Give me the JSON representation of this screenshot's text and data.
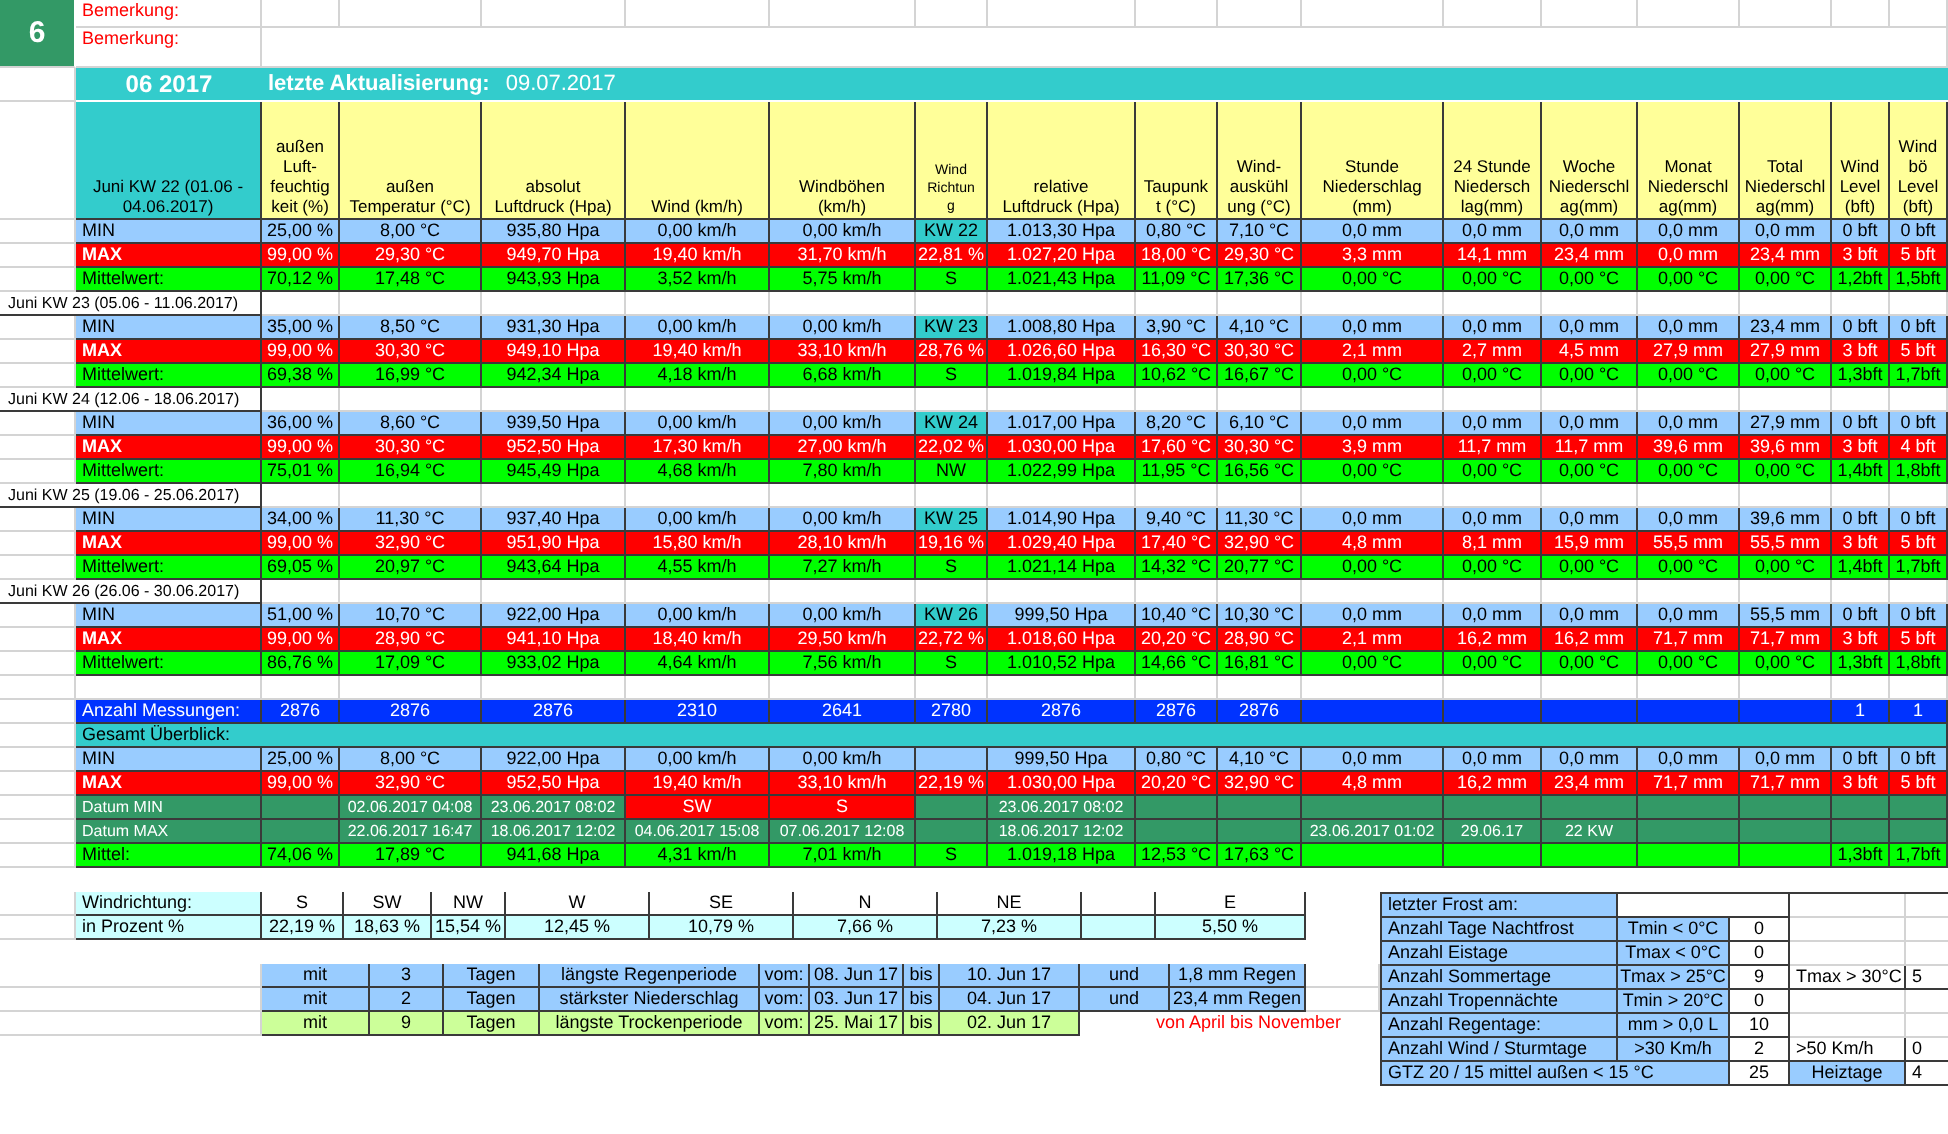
{
  "sheet_number": "6",
  "remarks": [
    "Bemerkung:",
    "Bemerkung:"
  ],
  "title": {
    "period": "06 2017",
    "update_label": "letzte Aktualisierung:",
    "update_date": "09.07.2017"
  },
  "columns": [
    "außen\nLuft-\nfeuchtig\nkeit (%)",
    "außen\nTemperatur (°C)",
    "absolut\nLuftdruck (Hpa)",
    "Wind  (km/h)",
    "Windböhen\n(km/h)",
    "Wind\nRichtun\ng",
    "relative\nLuftdruck (Hpa)",
    "Taupunk\nt (°C)",
    "Wind-\nauskühl\nung (°C)",
    "Stunde\nNiederschlag\n(mm)",
    "24 Stunde\nNiedersch\nlag(mm)",
    "Woche\nNiederschl\nag(mm)",
    "Monat\nNiederschl\nag(mm)",
    "Total\nNiederschl\nag(mm)",
    "Wind\nLevel\n(bft)",
    "Wind\nbö\nLevel\n(bft)"
  ],
  "weeks": [
    {
      "label": "Juni KW 22 (01.06 - 04.06.2017)",
      "rows": [
        {
          "kind": "min",
          "label": "MIN",
          "cells": [
            "25,00 %",
            "8,00 °C",
            "935,80 Hpa",
            "0,00 km/h",
            "0,00 km/h",
            {
              "text": "KW 22",
              "kind": "week"
            },
            "1.013,30 Hpa",
            "0,80 °C",
            "7,10 °C",
            "0,0 mm",
            "0,0 mm",
            "0,0 mm",
            "0,0 mm",
            "0,0 mm",
            "0 bft",
            "0 bft"
          ]
        },
        {
          "kind": "max",
          "label": "MAX",
          "cells": [
            "99,00 %",
            "29,30 °C",
            "949,70 Hpa",
            "19,40 km/h",
            "31,70 km/h",
            "22,81 %",
            "1.027,20 Hpa",
            "18,00 °C",
            "29,30 °C",
            "3,3 mm",
            "14,1 mm",
            "23,4 mm",
            "0,0 mm",
            "23,4 mm",
            "3 bft",
            "5 bft"
          ]
        },
        {
          "kind": "mean",
          "label": "Mittelwert:",
          "cells": [
            "70,12 %",
            "17,48 °C",
            "943,93 Hpa",
            "3,52 km/h",
            "5,75 km/h",
            "S",
            "1.021,43 Hpa",
            "11,09 °C",
            "17,36 °C",
            "0,00 °C",
            "0,00 °C",
            "0,00 °C",
            "0,00 °C",
            "0,00 °C",
            "1,2bft",
            "1,5bft"
          ]
        }
      ]
    },
    {
      "label": "Juni KW 23 (05.06 - 11.06.2017)",
      "rows": [
        {
          "kind": "min",
          "label": "MIN",
          "cells": [
            "35,00 %",
            "8,50 °C",
            "931,30 Hpa",
            "0,00 km/h",
            "0,00 km/h",
            {
              "text": "KW 23",
              "kind": "week"
            },
            "1.008,80 Hpa",
            "3,90 °C",
            "4,10 °C",
            "0,0 mm",
            "0,0 mm",
            "0,0 mm",
            "0,0 mm",
            "23,4 mm",
            "0 bft",
            "0 bft"
          ]
        },
        {
          "kind": "max",
          "label": "MAX",
          "cells": [
            "99,00 %",
            "30,30 °C",
            "949,10 Hpa",
            "19,40 km/h",
            "33,10 km/h",
            "28,76 %",
            "1.026,60 Hpa",
            "16,30 °C",
            "30,30 °C",
            "2,1 mm",
            "2,7 mm",
            "4,5 mm",
            "27,9 mm",
            "27,9 mm",
            "3 bft",
            "5 bft"
          ]
        },
        {
          "kind": "mean",
          "label": "Mittelwert:",
          "cells": [
            "69,38 %",
            "16,99 °C",
            "942,34 Hpa",
            "4,18 km/h",
            "6,68 km/h",
            "S",
            "1.019,84 Hpa",
            "10,62 °C",
            "16,67 °C",
            "0,00 °C",
            "0,00 °C",
            "0,00 °C",
            "0,00 °C",
            "0,00 °C",
            "1,3bft",
            "1,7bft"
          ]
        }
      ]
    },
    {
      "label": "Juni KW 24 (12.06 - 18.06.2017)",
      "rows": [
        {
          "kind": "min",
          "label": "MIN",
          "cells": [
            "36,00 %",
            "8,60 °C",
            "939,50 Hpa",
            "0,00 km/h",
            "0,00 km/h",
            {
              "text": "KW 24",
              "kind": "week"
            },
            "1.017,00 Hpa",
            "8,20 °C",
            "6,10 °C",
            "0,0 mm",
            "0,0 mm",
            "0,0 mm",
            "0,0 mm",
            "27,9 mm",
            "0 bft",
            "0 bft"
          ]
        },
        {
          "kind": "max",
          "label": "MAX",
          "cells": [
            "99,00 %",
            "30,30 °C",
            "952,50 Hpa",
            "17,30 km/h",
            "27,00 km/h",
            "22,02 %",
            "1.030,00 Hpa",
            "17,60 °C",
            "30,30 °C",
            "3,9 mm",
            "11,7 mm",
            "11,7 mm",
            "39,6 mm",
            "39,6 mm",
            "3 bft",
            "4 bft"
          ]
        },
        {
          "kind": "mean",
          "label": "Mittelwert:",
          "cells": [
            "75,01 %",
            "16,94 °C",
            "945,49 Hpa",
            "4,68 km/h",
            "7,80 km/h",
            "NW",
            "1.022,99 Hpa",
            "11,95 °C",
            "16,56 °C",
            "0,00 °C",
            "0,00 °C",
            "0,00 °C",
            "0,00 °C",
            "0,00 °C",
            "1,4bft",
            "1,8bft"
          ]
        }
      ]
    },
    {
      "label": "Juni KW 25 (19.06 - 25.06.2017)",
      "rows": [
        {
          "kind": "min",
          "label": "MIN",
          "cells": [
            "34,00 %",
            "11,30 °C",
            "937,40 Hpa",
            "0,00 km/h",
            "0,00 km/h",
            {
              "text": "KW 25",
              "kind": "week"
            },
            "1.014,90 Hpa",
            "9,40 °C",
            "11,30 °C",
            "0,0 mm",
            "0,0 mm",
            "0,0 mm",
            "0,0 mm",
            "39,6 mm",
            "0 bft",
            "0 bft"
          ]
        },
        {
          "kind": "max",
          "label": "MAX",
          "cells": [
            "99,00 %",
            "32,90 °C",
            "951,90 Hpa",
            "15,80 km/h",
            "28,10 km/h",
            "19,16 %",
            "1.029,40 Hpa",
            "17,40 °C",
            "32,90 °C",
            "4,8 mm",
            "8,1 mm",
            "15,9 mm",
            "55,5 mm",
            "55,5 mm",
            "3 bft",
            "5 bft"
          ]
        },
        {
          "kind": "mean",
          "label": "Mittelwert:",
          "cells": [
            "69,05 %",
            "20,97 °C",
            "943,64 Hpa",
            "4,55 km/h",
            "7,27 km/h",
            "S",
            "1.021,14 Hpa",
            "14,32 °C",
            "20,77 °C",
            "0,00 °C",
            "0,00 °C",
            "0,00 °C",
            "0,00 °C",
            "0,00 °C",
            "1,4bft",
            "1,7bft"
          ]
        }
      ]
    },
    {
      "label": "Juni KW 26 (26.06 - 30.06.2017)",
      "rows": [
        {
          "kind": "min",
          "label": "MIN",
          "cells": [
            "51,00 %",
            "10,70 °C",
            "922,00 Hpa",
            "0,00 km/h",
            "0,00 km/h",
            {
              "text": "KW 26",
              "kind": "week"
            },
            "999,50 Hpa",
            "10,40 °C",
            "10,30 °C",
            "0,0 mm",
            "0,0 mm",
            "0,0 mm",
            "0,0 mm",
            "55,5 mm",
            "0 bft",
            "0 bft"
          ]
        },
        {
          "kind": "max",
          "label": "MAX",
          "cells": [
            "99,00 %",
            "28,90 °C",
            "941,10 Hpa",
            "18,40 km/h",
            "29,50 km/h",
            "22,72 %",
            "1.018,60 Hpa",
            "20,20 °C",
            "28,90 °C",
            "2,1 mm",
            "16,2 mm",
            "16,2 mm",
            "71,7 mm",
            "71,7 mm",
            "3 bft",
            "5 bft"
          ]
        },
        {
          "kind": "mean",
          "label": "Mittelwert:",
          "cells": [
            "86,76 %",
            "17,09 °C",
            "933,02 Hpa",
            "4,64 km/h",
            "7,56 km/h",
            "S",
            "1.010,52 Hpa",
            "14,66 °C",
            "16,81 °C",
            "0,00 °C",
            "0,00 °C",
            "0,00 °C",
            "0,00 °C",
            "0,00 °C",
            "1,3bft",
            "1,8bft"
          ]
        }
      ]
    }
  ],
  "summary": {
    "count": {
      "kind": "count",
      "label": "Anzahl Messungen:",
      "cells": [
        "2876",
        "2876",
        "2876",
        "2310",
        "2641",
        "2780",
        "2876",
        "2876",
        "2876",
        null,
        null,
        null,
        null,
        null,
        "1",
        "1"
      ]
    },
    "overview_label": "Gesamt Überblick:",
    "rows": [
      {
        "kind": "min",
        "label": "MIN",
        "cells": [
          "25,00 %",
          "8,00 °C",
          "922,00 Hpa",
          "0,00 km/h",
          "0,00 km/h",
          null,
          "999,50 Hpa",
          "0,80 °C",
          "4,10 °C",
          "0,0 mm",
          "0,0 mm",
          "0,0 mm",
          "0,0 mm",
          "0,0 mm",
          "0 bft",
          "0 bft"
        ]
      },
      {
        "kind": "max",
        "label": "MAX",
        "cells": [
          "99,00 %",
          "32,90 °C",
          "952,50 Hpa",
          "19,40 km/h",
          "33,10 km/h",
          "22,19 %",
          "1.030,00 Hpa",
          "20,20 °C",
          "32,90 °C",
          "4,8 mm",
          "16,2 mm",
          "23,4 mm",
          "71,7 mm",
          "71,7 mm",
          "3 bft",
          "5 bft"
        ]
      },
      {
        "kind": "date",
        "label": "Datum MIN",
        "cells": [
          null,
          "02.06.2017 04:08",
          "23.06.2017 08:02",
          {
            "text": "SW",
            "kind": "alert"
          },
          {
            "text": "S",
            "kind": "alert"
          },
          null,
          "23.06.2017 08:02",
          null,
          null,
          null,
          null,
          null,
          null,
          null,
          null,
          null
        ]
      },
      {
        "kind": "date",
        "label": "Datum MAX",
        "cells": [
          null,
          "22.06.2017 16:47",
          "18.06.2017 12:02",
          "04.06.2017 15:08",
          "07.06.2017 12:08",
          null,
          "18.06.2017 12:02",
          null,
          null,
          "23.06.2017 01:02",
          "29.06.17",
          "22 KW",
          null,
          null,
          null,
          null
        ]
      },
      {
        "kind": "mean",
        "label": "Mittel:",
        "cells": [
          "74,06 %",
          "17,89 °C",
          "941,68 Hpa",
          "4,31 km/h",
          "7,01 km/h",
          "S",
          "1.019,18 Hpa",
          "12,53 °C",
          "17,63 °C",
          null,
          null,
          null,
          null,
          null,
          "1,3bft",
          "1,7bft"
        ]
      }
    ]
  },
  "wind_directions": {
    "label": "Windrichtung:",
    "share_label": "in Prozent %",
    "items": [
      {
        "kind": "direction",
        "direction": "S",
        "share": "22,19 %"
      },
      {
        "kind": "direction",
        "direction": "SW",
        "share": "18,63 %"
      },
      {
        "kind": "direction",
        "direction": "NW",
        "share": "15,54 %"
      },
      {
        "kind": "direction",
        "direction": "W",
        "share": "12,45 %"
      },
      {
        "kind": "direction",
        "direction": "SE",
        "share": "10,79 %"
      },
      {
        "kind": "direction",
        "direction": "N",
        "share": "7,66 %"
      },
      {
        "kind": "direction",
        "direction": "NE",
        "share": "7,23 %"
      },
      {
        "kind": "empty"
      },
      {
        "kind": "direction",
        "direction": "E",
        "share": "5,50 %"
      }
    ]
  },
  "periods": [
    {
      "kind": "rain",
      "prefix": "mit",
      "days": "3",
      "unit": "Tagen",
      "title": "längste Regenperiode",
      "from_label": "vom:",
      "from": "08. Jun 17",
      "to_label": "bis",
      "to": "10. Jun 17",
      "and_label": "und",
      "amount": "1,8 mm Regen"
    },
    {
      "kind": "rain",
      "prefix": "mit",
      "days": "2",
      "unit": "Tagen",
      "title": "stärkster Niederschlag",
      "from_label": "vom:",
      "from": "03. Jun 17",
      "to_label": "bis",
      "to": "04. Jun 17",
      "and_label": "und",
      "amount": "23,4 mm Regen"
    },
    {
      "kind": "dry",
      "prefix": "mit",
      "days": "9",
      "unit": "Tagen",
      "title": "längste Trockenperiode",
      "from_label": "vom:",
      "from": "25. Mai 17",
      "to_label": "bis",
      "to": "02. Jun 17"
    }
  ],
  "season_note": "von April bis November",
  "stats": [
    {
      "kind": "heading",
      "label": "letzter Frost am:"
    },
    {
      "kind": "count",
      "label": "Anzahl Tage Nachtfrost",
      "condition": "Tmin < 0°C",
      "value": "0"
    },
    {
      "kind": "count",
      "label": "Anzahl Eistage",
      "condition": "Tmax < 0°C",
      "value": "0"
    },
    {
      "kind": "count",
      "label": "Anzahl Sommertage",
      "condition": "Tmax > 25°C",
      "value": "9",
      "extra_label": "Tmax > 30°C",
      "extra_value": "5"
    },
    {
      "kind": "count",
      "label": "Anzahl Tropennächte",
      "condition": "Tmin > 20°C",
      "value": "0"
    },
    {
      "kind": "count",
      "label": "Anzahl Regentage:",
      "condition": "mm > 0,0 L",
      "value": "10"
    },
    {
      "kind": "count",
      "label": "Anzahl Wind / Sturmtage",
      "condition": ">30 Km/h",
      "value": "2",
      "extra_label": ">50 Km/h",
      "extra_value": "0"
    },
    {
      "kind": "degree_days",
      "label": "GTZ 20 / 15 mittel außen < 15 °C",
      "value": "25",
      "extra_label": "Heiztage",
      "extra_value": "4"
    }
  ]
}
